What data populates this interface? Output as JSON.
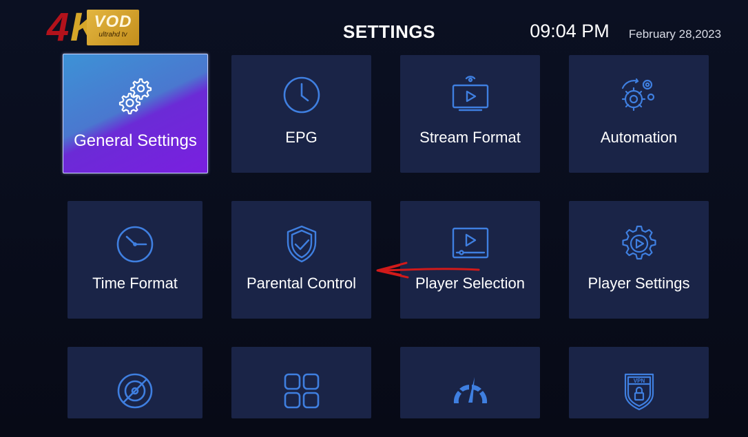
{
  "header": {
    "logo_4": "4",
    "logo_k": "K",
    "logo_vod": "VOD",
    "logo_sub": "ultrahd tv",
    "title": "SETTINGS",
    "time": "09:04 PM",
    "date": "February 28,2023"
  },
  "tiles": [
    {
      "label": "General Settings",
      "icon": "gear-group-icon",
      "selected": true
    },
    {
      "label": "EPG",
      "icon": "clock-icon"
    },
    {
      "label": "Stream Format",
      "icon": "stream-tv-icon"
    },
    {
      "label": "Automation",
      "icon": "gear-arrows-icon"
    },
    {
      "label": "Time Format",
      "icon": "time-clock-icon"
    },
    {
      "label": "Parental Control",
      "icon": "shield-check-icon"
    },
    {
      "label": "Player Selection",
      "icon": "player-screen-icon"
    },
    {
      "label": "Player Settings",
      "icon": "gear-play-icon"
    },
    {
      "label": "",
      "icon": "disc-off-icon"
    },
    {
      "label": "",
      "icon": "grid-apps-icon"
    },
    {
      "label": "",
      "icon": "speedometer-icon"
    },
    {
      "label": "",
      "icon": "vpn-shield-icon"
    }
  ],
  "colors": {
    "accent_icon": "#3f7fe0",
    "tile_bg": "#1a2447",
    "annotation_arrow": "#d11a1a"
  }
}
